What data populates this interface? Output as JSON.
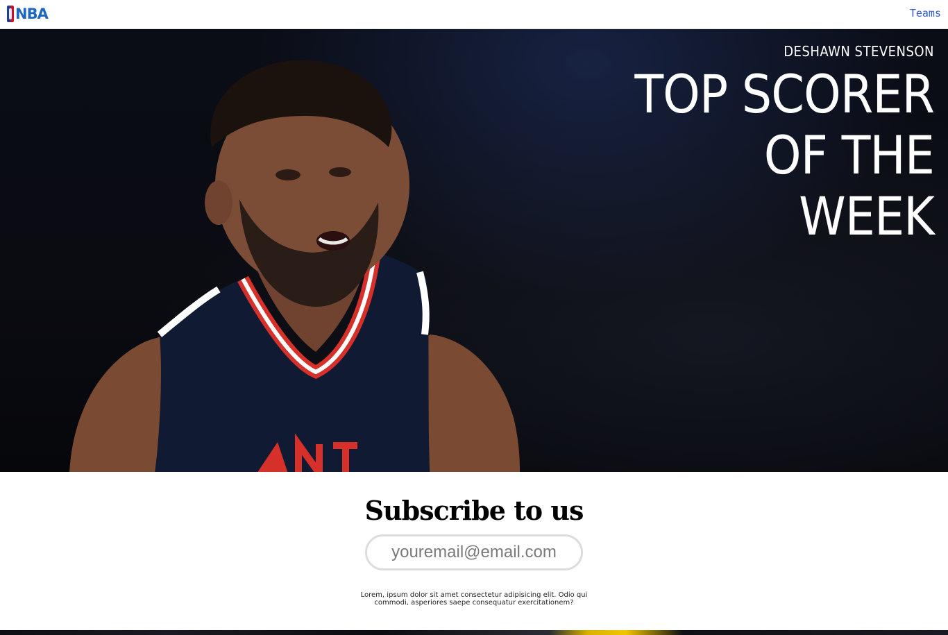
{
  "nav": {
    "logo_text": "NBA",
    "teams_link": "Teams"
  },
  "hero": {
    "player_name": "DESHAWN STEVENSON",
    "title_lines": [
      "TOP SCORER",
      "OF THE",
      "WEEK"
    ]
  },
  "subscribe": {
    "heading": "Subscribe to us",
    "email_placeholder": "youremail@email.com",
    "fine_print": "Lorem, ipsum dolor sit amet consectetur adipisicing elit. Odio qui commodi, asperiores saepe consequatur exercitationem?"
  },
  "colors": {
    "link": "#2e5bdb",
    "logo_blue": "#1d428a",
    "logo_red": "#c8102e"
  },
  "icons": {
    "logo": "nba-logo-icon"
  }
}
